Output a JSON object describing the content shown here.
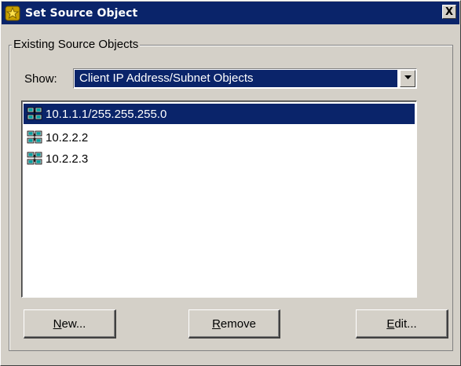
{
  "window": {
    "title": "Set Source Object",
    "title_icon": "gold-star-badge-icon",
    "close_symbol": "X"
  },
  "group": {
    "label": "Existing Source Objects"
  },
  "show": {
    "label": "Show:",
    "selected": "Client IP Address/Subnet Objects"
  },
  "list": {
    "items": [
      {
        "label": "10.1.1.1/255.255.255.0",
        "icon": "network-computers-icon",
        "selected": true
      },
      {
        "label": "10.2.2.2",
        "icon": "network-computers-icon",
        "selected": false
      },
      {
        "label": "10.2.2.3",
        "icon": "network-computers-icon",
        "selected": false
      }
    ]
  },
  "buttons": {
    "new": {
      "mnemonic": "N",
      "rest": "ew..."
    },
    "remove": {
      "mnemonic": "R",
      "rest": "emove"
    },
    "edit": {
      "mnemonic": "E",
      "rest": "dit..."
    }
  },
  "colors": {
    "titlebar": "#0a246a",
    "selection": "#0a246a",
    "face": "#d4d0c8"
  }
}
